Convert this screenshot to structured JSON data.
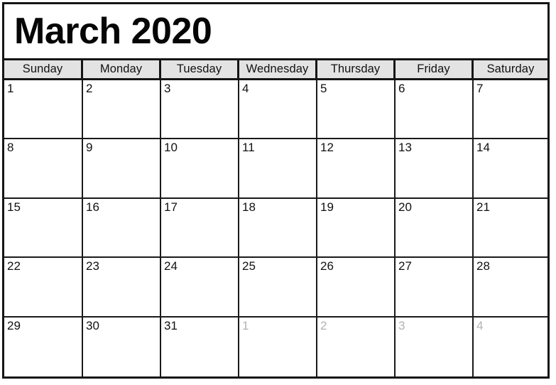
{
  "title": "March 2020",
  "weekdays": [
    "Sunday",
    "Monday",
    "Tuesday",
    "Wednesday",
    "Thursday",
    "Friday",
    "Saturday"
  ],
  "colors": {
    "header_background": "#e3e3e3",
    "grid_line": "#151515",
    "text": "#111111",
    "muted_text": "#b3b3b3",
    "cell_background": "#ffffff"
  },
  "weeks": [
    [
      {
        "label": "1",
        "muted": false
      },
      {
        "label": "2",
        "muted": false
      },
      {
        "label": "3",
        "muted": false
      },
      {
        "label": "4",
        "muted": false
      },
      {
        "label": "5",
        "muted": false
      },
      {
        "label": "6",
        "muted": false
      },
      {
        "label": "7",
        "muted": false
      }
    ],
    [
      {
        "label": "8",
        "muted": false
      },
      {
        "label": "9",
        "muted": false
      },
      {
        "label": "10",
        "muted": false
      },
      {
        "label": "11",
        "muted": false
      },
      {
        "label": "12",
        "muted": false
      },
      {
        "label": "13",
        "muted": false
      },
      {
        "label": "14",
        "muted": false
      }
    ],
    [
      {
        "label": "15",
        "muted": false
      },
      {
        "label": "16",
        "muted": false
      },
      {
        "label": "17",
        "muted": false
      },
      {
        "label": "18",
        "muted": false
      },
      {
        "label": "19",
        "muted": false
      },
      {
        "label": "20",
        "muted": false
      },
      {
        "label": "21",
        "muted": false
      }
    ],
    [
      {
        "label": "22",
        "muted": false
      },
      {
        "label": "23",
        "muted": false
      },
      {
        "label": "24",
        "muted": false
      },
      {
        "label": "25",
        "muted": false
      },
      {
        "label": "26",
        "muted": false
      },
      {
        "label": "27",
        "muted": false
      },
      {
        "label": "28",
        "muted": false
      }
    ],
    [
      {
        "label": "29",
        "muted": false
      },
      {
        "label": "30",
        "muted": false
      },
      {
        "label": "31",
        "muted": false
      },
      {
        "label": "1",
        "muted": true
      },
      {
        "label": "2",
        "muted": true
      },
      {
        "label": "3",
        "muted": true
      },
      {
        "label": "4",
        "muted": true
      }
    ]
  ]
}
